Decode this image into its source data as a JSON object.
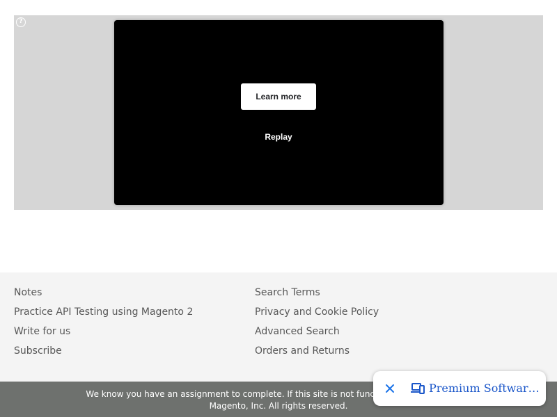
{
  "ad": {
    "info_icon": "help-circle-icon",
    "learn_more_label": "Learn more",
    "replay_label": "Replay"
  },
  "footer": {
    "left_links": [
      "Notes",
      "Practice API Testing using Magento 2",
      "Write for us",
      "Subscribe"
    ],
    "right_links": [
      "Search Terms",
      "Privacy and Cookie Policy",
      "Advanced Search",
      "Orders and Returns"
    ]
  },
  "copyright": {
    "line1": "We know you have an assignment to complete. If this site is not functioning as expected, dr",
    "line2": "Magento, Inc. All rights reserved."
  },
  "toast": {
    "close_icon": "close-icon",
    "device_icon": "devices-icon",
    "text": "Premium Software Testing Tools",
    "accent_color": "#1a73e8"
  }
}
